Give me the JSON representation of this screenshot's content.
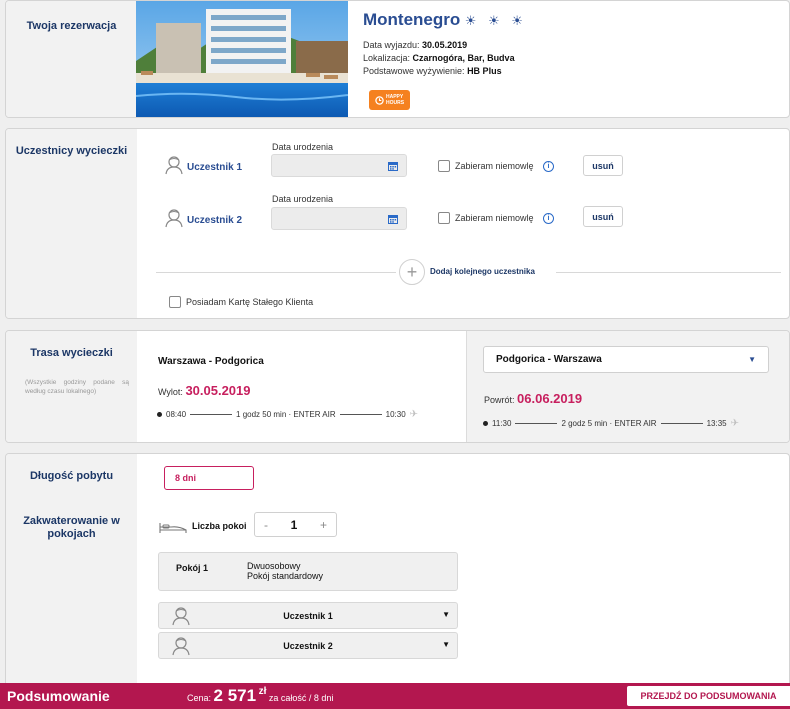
{
  "booking": {
    "section_title": "Twoja rezerwacja",
    "hotel_name": "Montenegro",
    "stars": "☀ ☀ ☀",
    "departure_label": "Data wyjazdu:",
    "departure_value": "30.05.2019",
    "location_label": "Lokalizacja:",
    "location_value": "Czarnogóra, Bar, Budva",
    "board_label": "Podstawowe wyżywienie:",
    "board_value": "HB Plus",
    "badge_line1": "HAPPY",
    "badge_line2": "HOURS"
  },
  "participants": {
    "section_title": "Uczestnicy wycieczki",
    "items": [
      {
        "name": "Uczestnik 1",
        "date_label": "Data urodzenia",
        "infant_label": "Zabieram niemowlę",
        "remove_label": "usuń"
      },
      {
        "name": "Uczestnik 2",
        "date_label": "Data urodzenia",
        "infant_label": "Zabieram niemowlę",
        "remove_label": "usuń"
      }
    ],
    "add_label": "Dodaj kolejnego uczestnika",
    "loyalty_label": "Posiadam Kartę Stałego Klienta"
  },
  "route": {
    "section_title": "Trasa wycieczki",
    "note": "(Wszystkie godziny podane są według czasu lokalnego)",
    "outbound": {
      "title": "Warszawa - Podgorica",
      "date_label": "Wylot:",
      "date": "30.05.2019",
      "dep_time": "08:40",
      "info": "1 godz 50 min · ENTER AIR",
      "arr_time": "10:30"
    },
    "return": {
      "title": "Podgorica - Warszawa",
      "date_label": "Powrót:",
      "date": "06.06.2019",
      "dep_time": "11:30",
      "info": "2 godz 5 min · ENTER AIR",
      "arr_time": "13:35"
    }
  },
  "stay": {
    "length_title": "Długość pobytu",
    "length_value": "8 dni",
    "rooms_title": "Zakwaterowanie w pokojach",
    "rooms_label": "Liczba pokoi",
    "rooms_minus": "-",
    "rooms_count": "1",
    "rooms_plus": "+",
    "room_label": "Pokój 1",
    "room_type_line1": "Dwuosobowy",
    "room_type_line2": "Pokój standardowy",
    "room_participants": [
      "Uczestnik 1",
      "Uczestnik 2"
    ]
  },
  "footer": {
    "title": "Podsumowanie",
    "price_label": "Cena:",
    "price_value": "2 571",
    "currency": "zł",
    "price_note": "za całość / 8 dni",
    "cta": "PRZEJDŹ DO PODSUMOWANIA"
  },
  "colors": {
    "accent": "#b3174f",
    "brand_blue": "#2a4d92",
    "badge_orange": "#f5811f"
  }
}
